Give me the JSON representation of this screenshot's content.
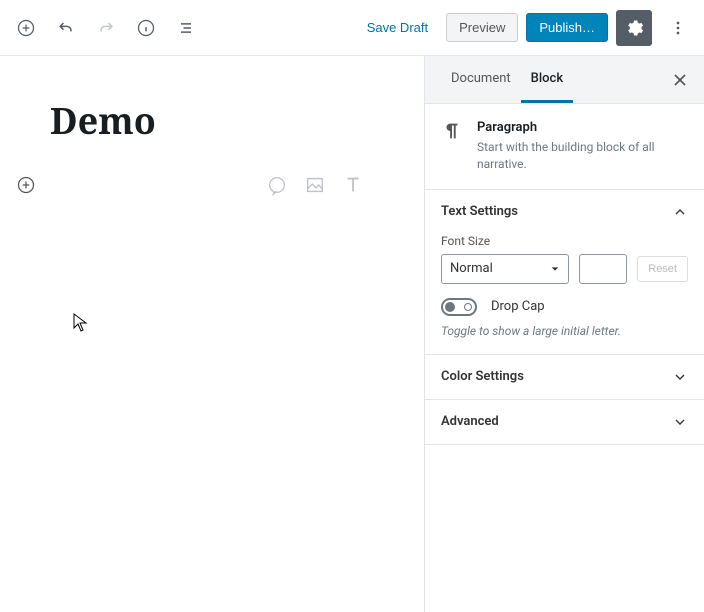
{
  "toolbar": {
    "save_draft": "Save Draft",
    "preview": "Preview",
    "publish": "Publish…"
  },
  "editor": {
    "title": "Demo"
  },
  "sidebar": {
    "tabs": {
      "document": "Document",
      "block": "Block"
    },
    "paragraph": {
      "title": "Paragraph",
      "desc": "Start with the building block of all narrative."
    },
    "text_settings": {
      "title": "Text Settings",
      "font_size_label": "Font Size",
      "font_size_value": "Normal",
      "reset": "Reset",
      "drop_cap": "Drop Cap",
      "drop_cap_hint": "Toggle to show a large initial letter."
    },
    "color_settings": {
      "title": "Color Settings"
    },
    "advanced": {
      "title": "Advanced"
    }
  }
}
